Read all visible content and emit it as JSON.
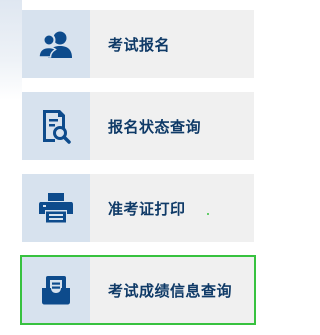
{
  "menu": {
    "items": [
      {
        "label": "考试报名",
        "icon": "users-icon"
      },
      {
        "label": "报名状态查询",
        "icon": "document-search-icon"
      },
      {
        "label": "准考证打印",
        "icon": "printer-icon"
      },
      {
        "label": "考试成绩信息查询",
        "icon": "inbox-tray-icon"
      }
    ],
    "active_index": 3
  },
  "colors": {
    "icon": "#0d4b8c",
    "label": "#0f3a67",
    "tile_bg": "#f0f0f0",
    "icon_bg": "#d7e2ee",
    "active_border": "#37c23f"
  }
}
